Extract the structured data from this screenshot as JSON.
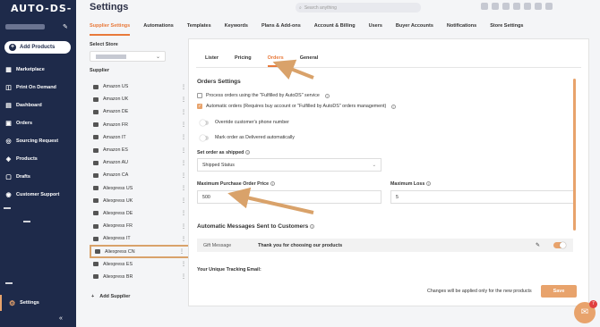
{
  "app": {
    "logo": "AUTO-DS-"
  },
  "sidebar": {
    "add_products": "Add Products",
    "items": [
      {
        "label": "Marketplace",
        "icon": "store-icon"
      },
      {
        "label": "Print On Demand",
        "icon": "shirt-icon"
      },
      {
        "label": "Dashboard",
        "icon": "chart-icon"
      },
      {
        "label": "Orders",
        "icon": "box-icon"
      },
      {
        "label": "Sourcing Request",
        "icon": "sourcing-icon"
      },
      {
        "label": "Products",
        "icon": "tag-icon"
      },
      {
        "label": "Drafts",
        "icon": "draft-icon"
      },
      {
        "label": "Customer Support",
        "icon": "support-icon"
      }
    ],
    "settings": "Settings",
    "collapse": "«"
  },
  "header": {
    "title": "Settings",
    "search_placeholder": "Search anything"
  },
  "top_tabs": [
    "Supplier Settings",
    "Automations",
    "Templates",
    "Keywords",
    "Plans & Add-ons",
    "Account & Billing",
    "Users",
    "Buyer Accounts",
    "Notifications",
    "Store Settings"
  ],
  "left": {
    "select_store_label": "Select Store",
    "supplier_label": "Supplier",
    "suppliers": [
      "Amazon US",
      "Amazon UK",
      "Amazon DE",
      "Amazon FR",
      "Amazon IT",
      "Amazon ES",
      "Amazon AU",
      "Amazon CA",
      "Aliexpress US",
      "Aliexpress UK",
      "Aliexpress DE",
      "Aliexpress FR",
      "Aliexpress IT",
      "Aliexpress CN",
      "Aliexpress ES",
      "Aliexpress BR"
    ],
    "selected_supplier": "Aliexpress CN",
    "add_supplier": "Add Supplier"
  },
  "panel": {
    "sub_tabs": [
      "Lister",
      "Pricing",
      "Orders",
      "General"
    ],
    "active_sub_tab": "Orders",
    "orders_heading": "Orders Settings",
    "opt_fulfilled": "Process orders using the \"Fulfilled by AutoDS\" service",
    "opt_automatic": "Automatic orders (Requires buy account or \"Fulfilled by AutoDS\" orders management)",
    "toggle_phone": "Override customer's phone number",
    "toggle_delivered": "Mark order as Delivered automatically",
    "set_shipped_label": "Set order as shipped",
    "set_shipped_value": "Shipped Status",
    "max_price_label": "Maximum Purchase Order Price",
    "max_price_value": "500",
    "max_loss_label": "Maximum Loss",
    "max_loss_value": "5",
    "auto_messages_heading": "Automatic Messages Sent to Customers",
    "gift_name": "Gift Message",
    "gift_text": "Thank you for choosing our products",
    "tracking_label": "Your Unique Tracking Email:",
    "footer_note": "Changes will be applied only for the new products",
    "save": "Save"
  },
  "chat": {
    "badge": "7"
  },
  "colors": {
    "accent": "#e8a36c",
    "sidebar": "#1e2a4a",
    "active_tab": "#e8793a"
  }
}
